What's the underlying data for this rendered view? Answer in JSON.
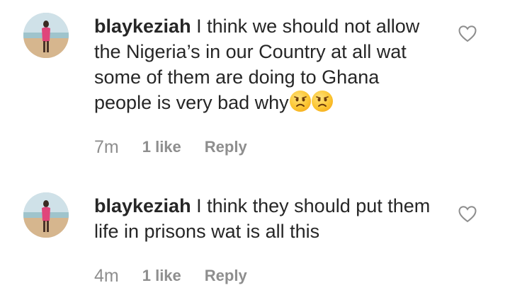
{
  "comments": [
    {
      "username": "blaykeziah",
      "text": "I think we should not allow the Nigeria’s in our Country at all wat some of them are doing to Ghana people is very bad why",
      "emojis": [
        "worried-face-emoji",
        "worried-face-emoji"
      ],
      "time": "7m",
      "likes": "1 like",
      "reply_label": "Reply"
    },
    {
      "username": "blaykeziah",
      "text": "I think they should put them life in prisons wat is all this",
      "emojis": [],
      "time": "4m",
      "likes": "1 like",
      "reply_label": "Reply"
    }
  ],
  "icons": {
    "like": "heart-outline-icon",
    "avatar": "avatar-photo"
  },
  "colors": {
    "text": "#262626",
    "meta": "#8e8e8e",
    "background": "#ffffff"
  }
}
